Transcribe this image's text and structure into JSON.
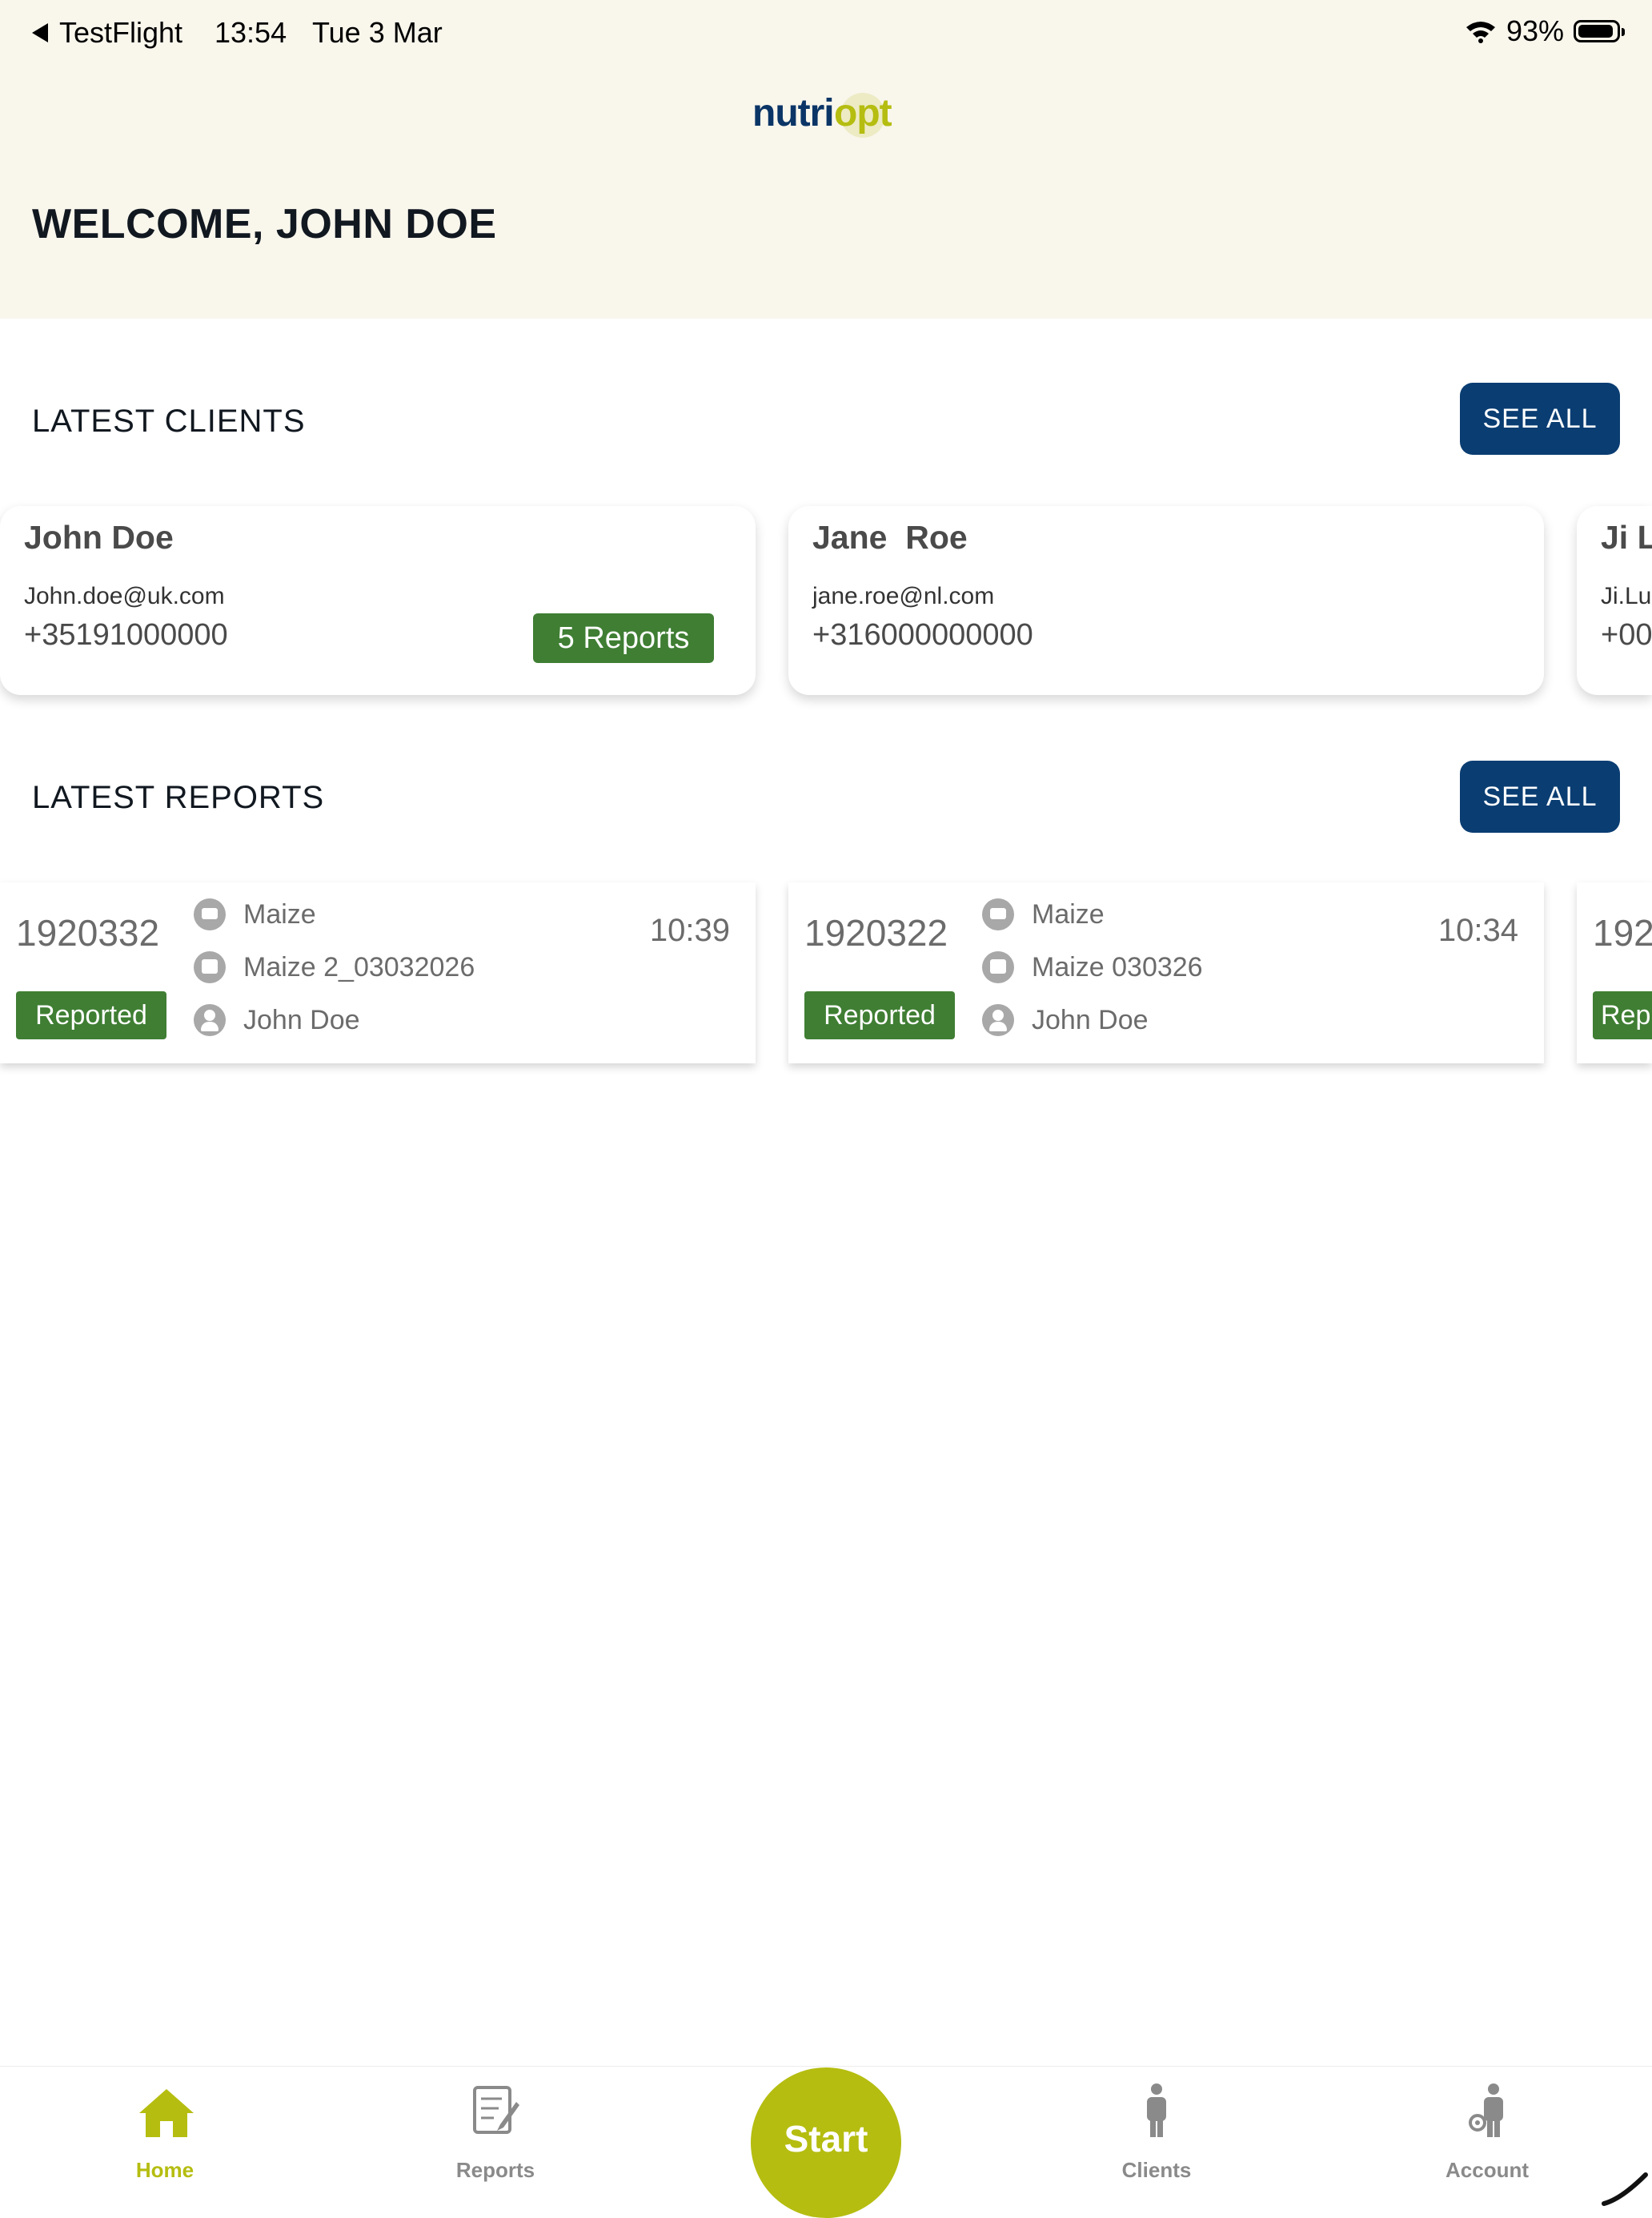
{
  "status_bar": {
    "back_label": "TestFlight",
    "time": "13:54",
    "date": "Tue 3 Mar",
    "battery": "93%"
  },
  "logo": {
    "part1": "nutri",
    "part2": "opt"
  },
  "welcome": "WELCOME, JOHN DOE",
  "clients_section": {
    "title": "LATEST CLIENTS",
    "see_all": "SEE ALL",
    "clients": [
      {
        "name": "John Doe",
        "email": "John.doe@uk.com",
        "phone": "+35191000000",
        "badge": "5 Reports"
      },
      {
        "name": "Jane  Roe",
        "email": "jane.roe@nl.com",
        "phone": "+316000000000"
      },
      {
        "name": "Ji L",
        "email": "Ji.Lu",
        "phone": "+00"
      }
    ]
  },
  "reports_section": {
    "title": "LATEST REPORTS",
    "see_all": "SEE ALL",
    "reports": [
      {
        "id": "1920332",
        "status": "Reported",
        "crop": "Maize",
        "sample": "Maize 2_03032026",
        "client": "John Doe",
        "time": "10:39"
      },
      {
        "id": "1920322",
        "status": "Reported",
        "crop": "Maize",
        "sample": "Maize 030326",
        "client": "John Doe",
        "time": "10:34"
      },
      {
        "id": "192",
        "status": "Rep"
      }
    ]
  },
  "tabs": {
    "home": "Home",
    "reports": "Reports",
    "start": "Start",
    "clients": "Clients",
    "account": "Account"
  },
  "colors": {
    "brand_navy": "#0a3d72",
    "brand_lime": "#b5bd10",
    "badge_green": "#3f7e33",
    "header_bg": "#f9f6ec"
  }
}
